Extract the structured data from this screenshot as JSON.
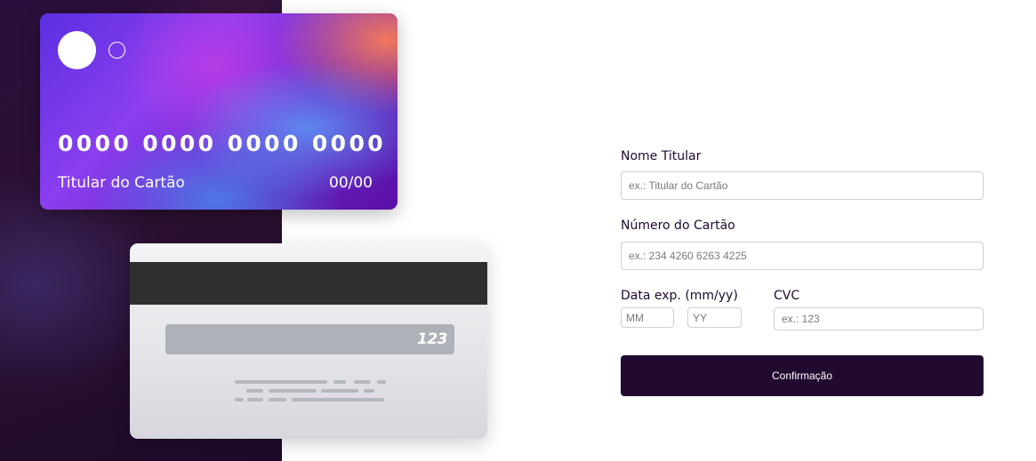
{
  "card_front": {
    "number": "0000 0000 0000 0000",
    "holder": "Titular do Cartão",
    "expiry": "00/00"
  },
  "card_back": {
    "cvc": "123"
  },
  "form": {
    "name_label": "Nome Titular",
    "name_placeholder": "ex.: Titular do Cartão",
    "number_label": "Número do Cartão",
    "number_placeholder": "ex.: 234 4260 6263 4225",
    "expiry_label": "Data exp. (mm/yy)",
    "month_placeholder": "MM",
    "year_placeholder": "YY",
    "cvc_label": "CVC",
    "cvc_placeholder": "ex.: 123",
    "confirm_label": "Confirmação"
  },
  "colors": {
    "primary": "#21092f",
    "input_border": "#cfcfd6"
  }
}
